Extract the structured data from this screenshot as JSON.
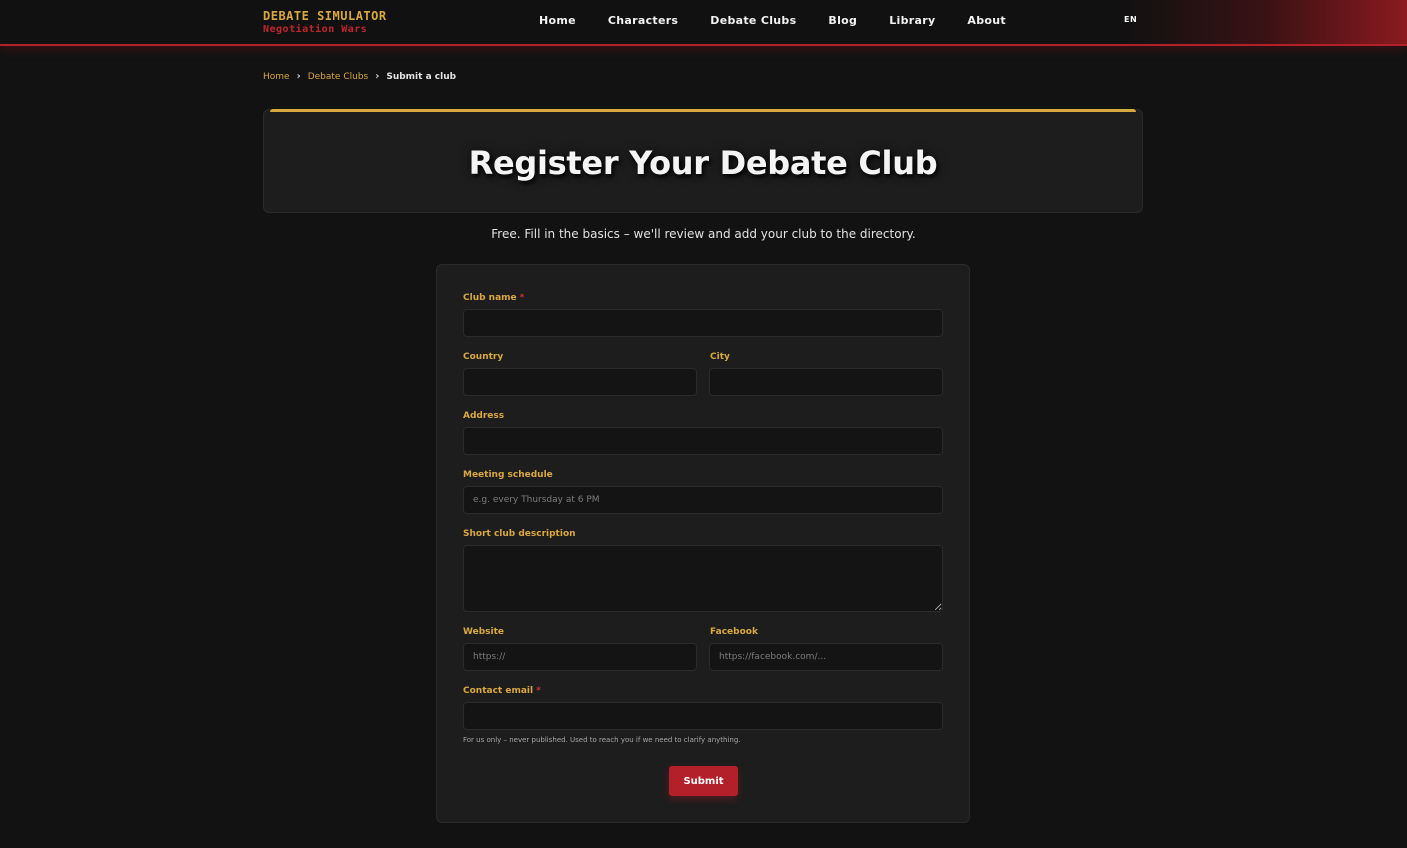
{
  "brand": {
    "title": "DEBATE SIMULATOR",
    "subtitle": "Negotiation Wars"
  },
  "nav": {
    "items": [
      "Home",
      "Characters",
      "Debate Clubs",
      "Blog",
      "Library",
      "About"
    ],
    "lang": "EN"
  },
  "breadcrumb": {
    "home": "Home",
    "section": "Debate Clubs",
    "current": "Submit a club"
  },
  "hero": {
    "title": "Register Your Debate Club"
  },
  "intro": "Free. Fill in the basics – we'll review and add your club to the directory.",
  "form": {
    "club_name": {
      "label": "Club name",
      "required": "*",
      "value": "",
      "placeholder": ""
    },
    "country": {
      "label": "Country",
      "value": "",
      "placeholder": ""
    },
    "city": {
      "label": "City",
      "value": "",
      "placeholder": ""
    },
    "address": {
      "label": "Address",
      "value": "",
      "placeholder": ""
    },
    "schedule": {
      "label": "Meeting schedule",
      "value": "",
      "placeholder": "e.g. every Thursday at 6 PM"
    },
    "description": {
      "label": "Short club description",
      "value": "",
      "placeholder": ""
    },
    "website": {
      "label": "Website",
      "value": "",
      "placeholder": "https://"
    },
    "facebook": {
      "label": "Facebook",
      "value": "",
      "placeholder": "https://facebook.com/..."
    },
    "email": {
      "label": "Contact email",
      "required": "*",
      "value": "",
      "placeholder": ""
    },
    "email_help": "For us only – never published. Used to reach you if we need to clarify anything.",
    "submit_label": "Submit"
  },
  "colors": {
    "accent_gold": "#d9a83e",
    "accent_red": "#b3202a",
    "background": "#121212",
    "card": "#1d1d1d"
  }
}
